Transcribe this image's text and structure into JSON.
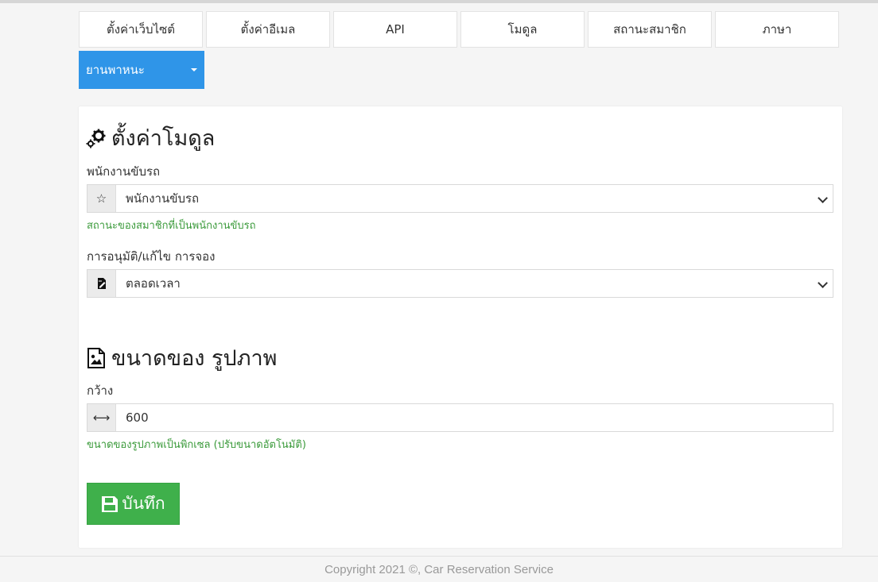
{
  "tabs": [
    {
      "label": "ตั้งค่าเว็บไซต์"
    },
    {
      "label": "ตั้งค่าอีเมล"
    },
    {
      "label": "API"
    },
    {
      "label": "โมดูล"
    },
    {
      "label": "สถานะสมาชิก"
    },
    {
      "label": "ภาษา"
    }
  ],
  "active_tab": {
    "label": "ยานพาหนะ",
    "icon": "caret-down-icon"
  },
  "module_section": {
    "title": "ตั้งค่าโมดูล",
    "icon": "cogs-icon",
    "driver": {
      "label": "พนักงานขับรถ",
      "icon": "star-icon",
      "value": "พนักงานขับรถ",
      "help": "สถานะของสมาชิกที่เป็นพนักงานขับรถ"
    },
    "approval": {
      "label": "การอนุมัติ/แก้ไข การจอง",
      "icon": "file-edit-icon",
      "value": "ตลอดเวลา"
    }
  },
  "image_section": {
    "title": "ขนาดของ รูปภาพ",
    "icon": "image-icon",
    "width": {
      "label": "กว้าง",
      "icon": "horizontal-arrows-icon",
      "value": "600",
      "help": "ขนาดของรูปภาพเป็นพิกเซล (ปรับขนาดอัตโนมัติ)"
    }
  },
  "save_button": {
    "label": "บันทึก",
    "icon": "floppy-disk-icon"
  },
  "footer": {
    "text": "Copyright 2021 ©, Car Reservation Service"
  },
  "colors": {
    "primary": "#2f95e8",
    "success": "#3fb04b",
    "help_text": "#3a9a3a"
  }
}
